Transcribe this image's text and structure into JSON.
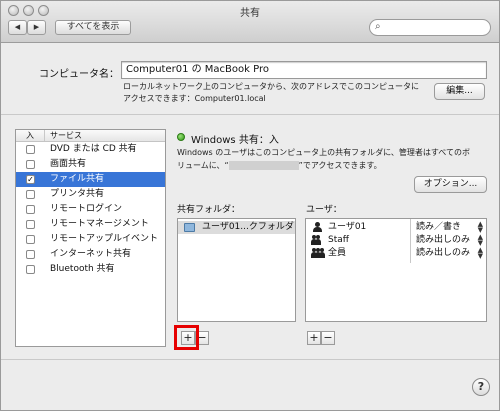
{
  "window": {
    "title": "共有"
  },
  "toolbar": {
    "back_glyph": "◀",
    "forward_glyph": "▶",
    "show_all_label": "すべてを表示",
    "search_value": ""
  },
  "computer": {
    "name_label": "コンピュータ名：",
    "name_value": "Computer01 の MacBook Pro",
    "address_line1": "ローカルネットワーク上のコンピュータから、次のアドレスでこのコンピュータに",
    "address_line2": "アクセスできます：Computer01.local",
    "edit_button": "編集..."
  },
  "services": {
    "header_on": "入",
    "header_service": "サービス",
    "items": [
      {
        "label": "DVD または CD 共有",
        "checked": false,
        "selected": false
      },
      {
        "label": "画面共有",
        "checked": false,
        "selected": false
      },
      {
        "label": "ファイル共有",
        "checked": true,
        "selected": true
      },
      {
        "label": "プリンタ共有",
        "checked": false,
        "selected": false
      },
      {
        "label": "リモートログイン",
        "checked": false,
        "selected": false
      },
      {
        "label": "リモートマネージメント",
        "checked": false,
        "selected": false
      },
      {
        "label": "リモートアップルイベント",
        "checked": false,
        "selected": false
      },
      {
        "label": "インターネット共有",
        "checked": false,
        "selected": false
      },
      {
        "label": "Bluetooth 共有",
        "checked": false,
        "selected": false
      }
    ]
  },
  "status": {
    "title": "Windows 共有：入",
    "desc_line1": "Windows のユーザはこのコンピュータ上の共有フォルダに、管理者はすべてのボ",
    "desc_line2_pre": "リュームに、“",
    "desc_line2_post": "”でアクセスできます。",
    "options_button": "オプション..."
  },
  "shared_folders": {
    "label": "共有フォルダ：",
    "items": [
      {
        "name": "ユーザ01...クフォルダ"
      }
    ],
    "add_button": "+",
    "remove_button": "−"
  },
  "users": {
    "label": "ユーザ：",
    "items": [
      {
        "name": "ユーザ01",
        "permission": "読み／書き",
        "icon": "user-icon"
      },
      {
        "name": "Staff",
        "permission": "読み出しのみ",
        "icon": "group-icon"
      },
      {
        "name": "全員",
        "permission": "読み出しのみ",
        "icon": "everyone-icon"
      }
    ],
    "add_button": "+",
    "remove_button": "−"
  },
  "help_glyph": "?",
  "colors": {
    "selection": "#3875d7",
    "status_on": "#2e9b13",
    "highlight_frame": "#e60000"
  }
}
